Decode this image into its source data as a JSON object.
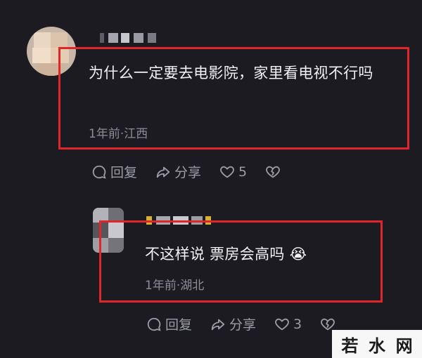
{
  "comment": {
    "text": "为什么一定要去电影院，家里看电视不行吗",
    "meta": "1年前·江西",
    "actions": {
      "reply_label": "回复",
      "share_label": "分享",
      "like_count": "5"
    }
  },
  "reply": {
    "text": "不这样说 票房会高吗 😭",
    "meta": "1年前·湖北",
    "actions": {
      "reply_label": "回复",
      "share_label": "分享",
      "like_count": "3"
    }
  },
  "watermark": {
    "chars": [
      "若",
      "水",
      "网"
    ]
  },
  "colors": {
    "background": "#1b1b21",
    "highlight": "#e0262b",
    "meta_text": "#8d8d96",
    "action_text": "#9c9ca5"
  },
  "icons": [
    "comment-icon",
    "share-icon",
    "heart-icon",
    "dislike-icon",
    "crying-laughing-emoji"
  ]
}
